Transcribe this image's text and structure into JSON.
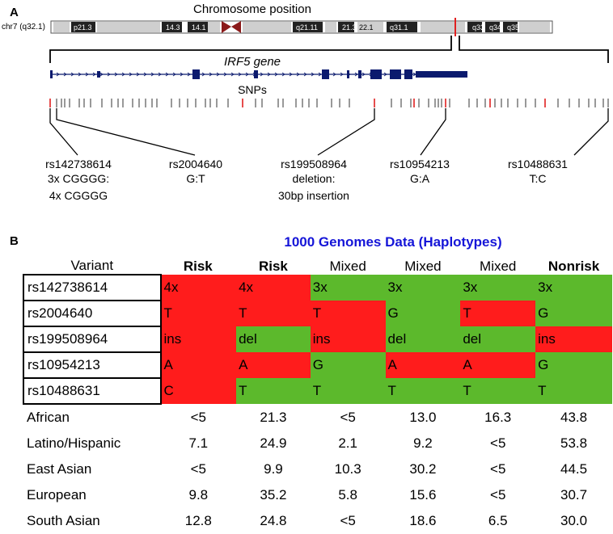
{
  "panel_a": {
    "letter": "A",
    "chromosome_title": "Chromosome position",
    "chromosome_name": "chr7 (q32.1)",
    "bands": [
      "p21.3",
      "14.3",
      "14.1",
      "q21.11",
      "21.3",
      "22.1",
      "q31.1",
      "q33",
      "q34",
      "q35"
    ],
    "gene_title": "IRF5 gene",
    "snps_title": "SNPs",
    "snp_labels": [
      {
        "id": "rs142738614",
        "lines": [
          "rs142738614",
          "3x CGGGG:",
          "4x CGGGG"
        ]
      },
      {
        "id": "rs2004640",
        "lines": [
          "rs2004640",
          "G:T"
        ]
      },
      {
        "id": "rs199508964",
        "lines": [
          "rs199508964",
          "deletion:",
          "30bp insertion"
        ]
      },
      {
        "id": "rs10954213",
        "lines": [
          "rs10954213",
          "G:A"
        ]
      },
      {
        "id": "rs10488631",
        "lines": [
          "rs10488631",
          "T:C"
        ]
      }
    ],
    "colors": {
      "gene": "#0b1a6e",
      "highlight": "#e02020",
      "centromere": "#8b1a1a"
    }
  },
  "panel_b": {
    "letter": "B",
    "title": "1000 Genomes Data (Haplotypes)",
    "variant_header": "Variant",
    "haplotype_headers": [
      {
        "label": "Risk",
        "bold": true
      },
      {
        "label": "Risk",
        "bold": true
      },
      {
        "label": "Mixed",
        "bold": false
      },
      {
        "label": "Mixed",
        "bold": false
      },
      {
        "label": "Mixed",
        "bold": false
      },
      {
        "label": "Nonrisk",
        "bold": true
      }
    ],
    "variants": [
      {
        "name": "rs142738614",
        "alleles": [
          [
            "4x",
            "risk"
          ],
          [
            "4x",
            "risk"
          ],
          [
            "3x",
            "nonrisk"
          ],
          [
            "3x",
            "nonrisk"
          ],
          [
            "3x",
            "nonrisk"
          ],
          [
            "3x",
            "nonrisk"
          ]
        ]
      },
      {
        "name": "rs2004640",
        "alleles": [
          [
            "T",
            "risk"
          ],
          [
            "T",
            "risk"
          ],
          [
            "T",
            "risk"
          ],
          [
            "G",
            "nonrisk"
          ],
          [
            "T",
            "risk"
          ],
          [
            "G",
            "nonrisk"
          ]
        ]
      },
      {
        "name": "rs199508964",
        "alleles": [
          [
            "ins",
            "risk"
          ],
          [
            "del",
            "nonrisk"
          ],
          [
            "ins",
            "risk"
          ],
          [
            "del",
            "nonrisk"
          ],
          [
            "del",
            "nonrisk"
          ],
          [
            "ins",
            "risk"
          ]
        ]
      },
      {
        "name": "rs10954213",
        "alleles": [
          [
            "A",
            "risk"
          ],
          [
            "A",
            "risk"
          ],
          [
            "G",
            "nonrisk"
          ],
          [
            "A",
            "risk"
          ],
          [
            "A",
            "risk"
          ],
          [
            "G",
            "nonrisk"
          ]
        ]
      },
      {
        "name": "rs10488631",
        "alleles": [
          [
            "C",
            "risk"
          ],
          [
            "T",
            "nonrisk"
          ],
          [
            "T",
            "nonrisk"
          ],
          [
            "T",
            "nonrisk"
          ],
          [
            "T",
            "nonrisk"
          ],
          [
            "T",
            "nonrisk"
          ]
        ]
      }
    ],
    "populations": [
      {
        "name": "African",
        "values": [
          "<5",
          "21.3",
          "<5",
          "13.0",
          "16.3",
          "43.8"
        ]
      },
      {
        "name": "Latino/Hispanic",
        "values": [
          "7.1",
          "24.9",
          "2.1",
          "9.2",
          "<5",
          "53.8"
        ]
      },
      {
        "name": "East Asian",
        "values": [
          "<5",
          "9.9",
          "10.3",
          "30.2",
          "<5",
          "44.5"
        ]
      },
      {
        "name": "European",
        "values": [
          "9.8",
          "35.2",
          "5.8",
          "15.6",
          "<5",
          "30.7"
        ]
      },
      {
        "name": "South Asian",
        "values": [
          "12.8",
          "24.8",
          "<5",
          "18.6",
          "6.5",
          "30.0"
        ]
      }
    ],
    "colors": {
      "risk": "#ff1c1c",
      "nonrisk": "#5cb92c",
      "title": "#1515d8"
    }
  }
}
